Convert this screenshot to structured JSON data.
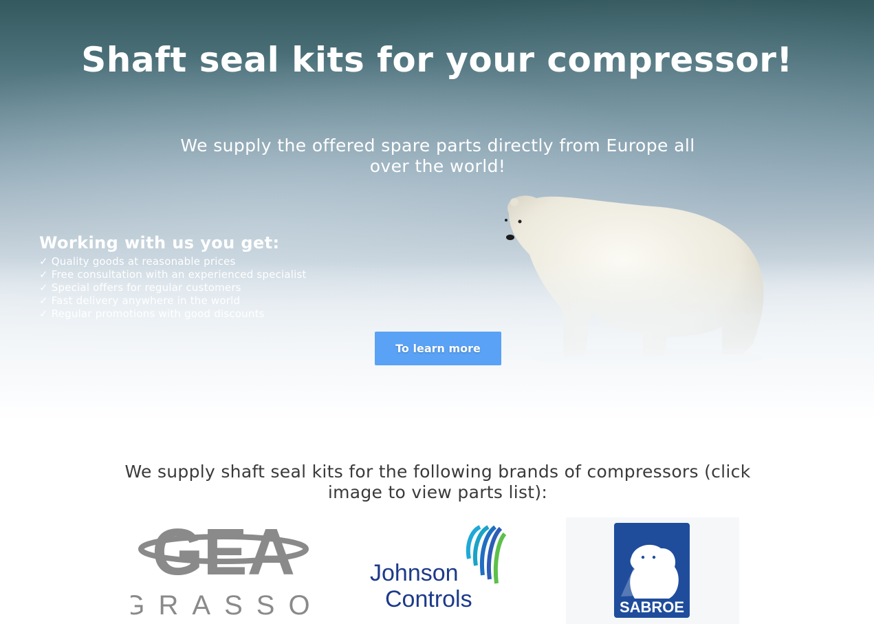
{
  "hero": {
    "title": "Shaft seal kits for your compressor!",
    "subtitle": "We supply the offered spare parts directly from Europe all over the world!",
    "benefits_title": "Working with us you get:",
    "benefits": [
      "✓ Quality goods at reasonable prices",
      "✓ Free consultation with an experienced specialist",
      "✓ Special offers for regular customers",
      "✓ Fast delivery anywhere in the world",
      "✓ Regular promotions with good discounts"
    ],
    "cta_label": "To learn more"
  },
  "brands": {
    "heading": "We supply shaft seal kits for the following brands of compressors (click image to view parts list):",
    "items": [
      {
        "logo_top": "GEA",
        "logo_bottom": "GRASSO"
      },
      {
        "logo_line1": "Johnson",
        "logo_line2": "Controls"
      },
      {
        "logo_text": "SABROE"
      }
    ]
  },
  "colors": {
    "cta": "#5aa2f5",
    "gea_gray": "#8a8a8a",
    "jc_blue": "#1d3a8a",
    "sabroe_blue": "#1f4d9c"
  }
}
